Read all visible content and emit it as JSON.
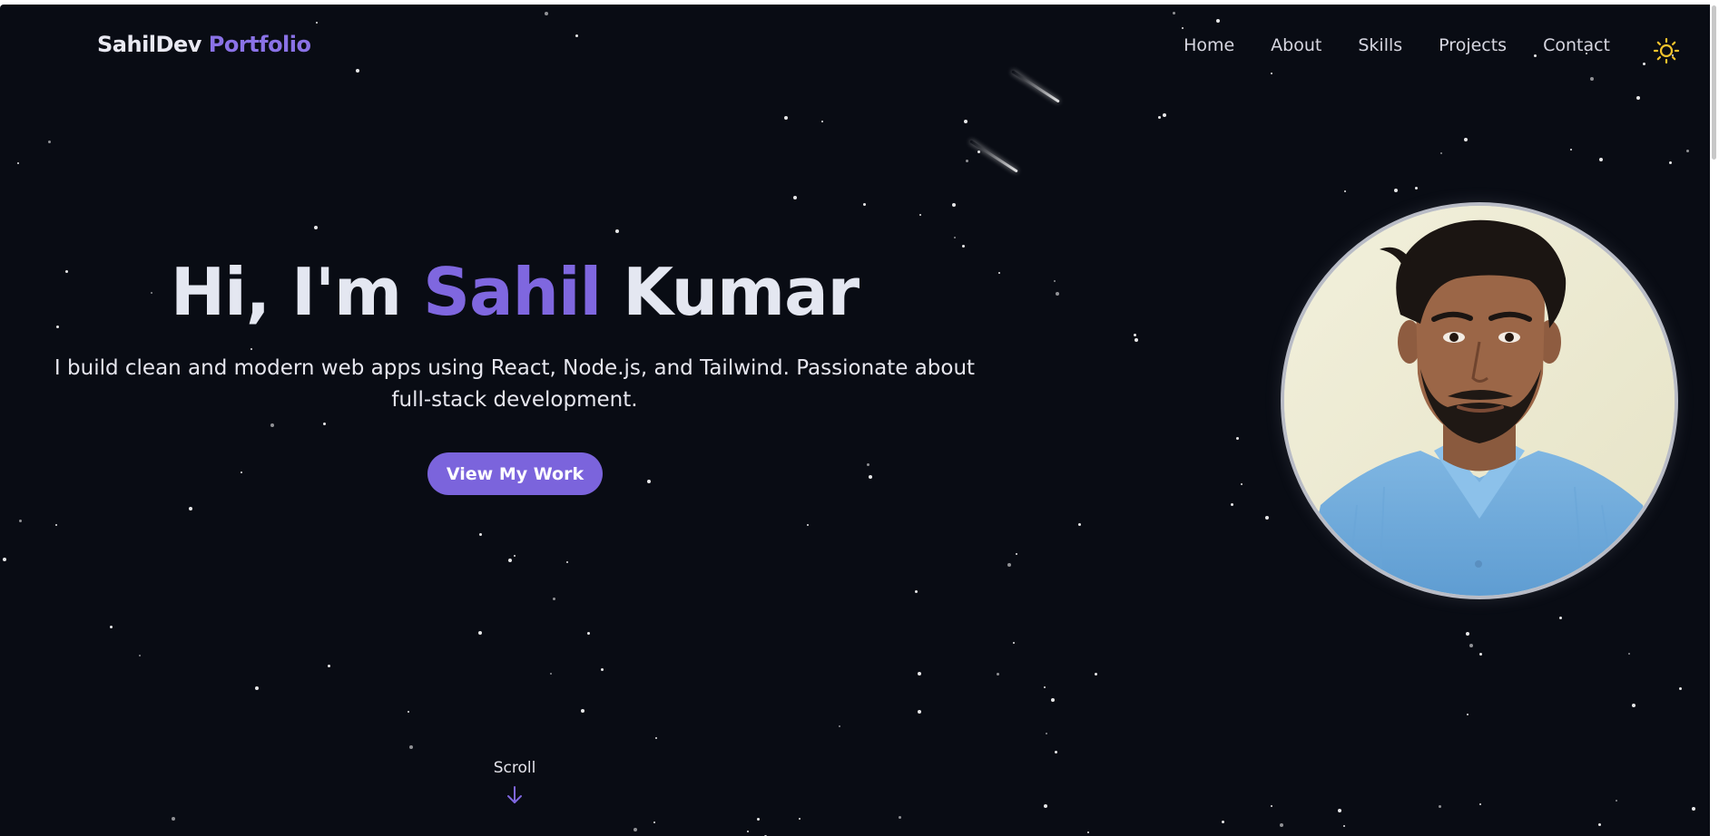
{
  "brand": {
    "name": "SahilDev",
    "accent": "Portfolio"
  },
  "nav": {
    "items": [
      {
        "label": "Home"
      },
      {
        "label": "About"
      },
      {
        "label": "Skills"
      },
      {
        "label": "Projects"
      },
      {
        "label": "Contact"
      }
    ],
    "theme_toggle_icon": "sun-icon"
  },
  "hero": {
    "greeting": "Hi, I'm",
    "first_name": "Sahil",
    "last_name": "Kumar",
    "subtitle": "I build clean and modern web apps using React, Node.js, and Tailwind. Passionate about full-stack development.",
    "cta_label": "View My Work",
    "scroll_label": "Scroll",
    "scroll_icon": "arrow-down-icon",
    "avatar_icon": "profile-photo"
  },
  "colors": {
    "background": "#090c14",
    "accent": "#7f67df",
    "text": "#e4e7f1",
    "sun": "#f3c32c"
  }
}
